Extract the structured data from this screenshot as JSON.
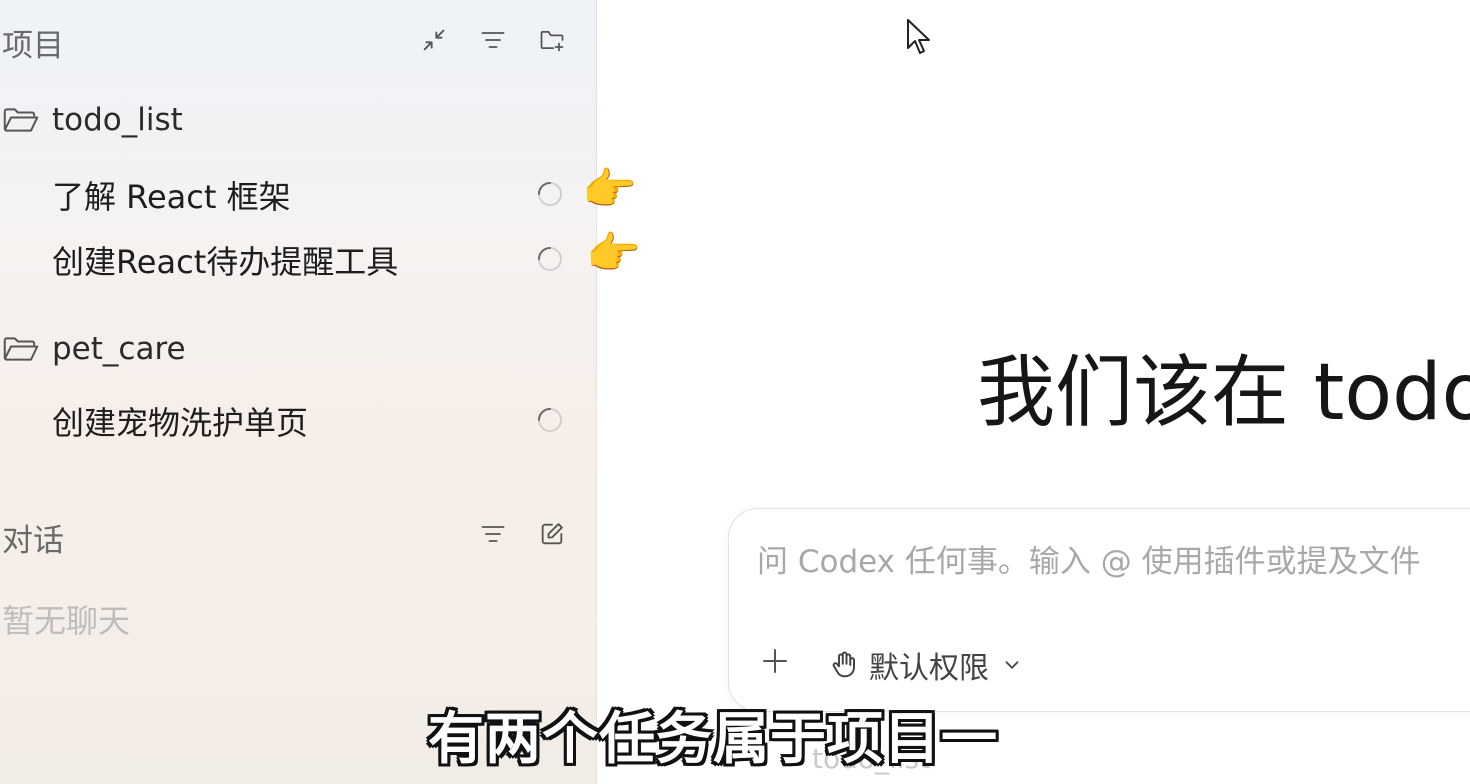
{
  "sidebar": {
    "projects_title": "项目",
    "projects_actions": [
      "collapse-icon",
      "filter-icon",
      "new-folder-icon"
    ],
    "projects": [
      {
        "name": "todo_list",
        "tasks": [
          {
            "title": "了解 React 框架",
            "status": "loading"
          },
          {
            "title": "创建React待办提醒工具",
            "status": "loading"
          }
        ]
      },
      {
        "name": "pet_care",
        "tasks": [
          {
            "title": "创建宠物洗护单页",
            "status": "loading"
          }
        ]
      }
    ],
    "chats_title": "对话",
    "chats_actions": [
      "filter-icon",
      "compose-icon"
    ],
    "chats_empty": "暂无聊天"
  },
  "main": {
    "headline": "我们该在 todo_list 中构建什么?",
    "composer": {
      "placeholder": "问 Codex 任何事。输入 @ 使用插件或提及文件",
      "permission_label": "默认权限"
    },
    "below_composer": "todo_list"
  },
  "overlay": {
    "subtitle": "有两个任务属于项目一",
    "pointer_emoji": "👉"
  }
}
